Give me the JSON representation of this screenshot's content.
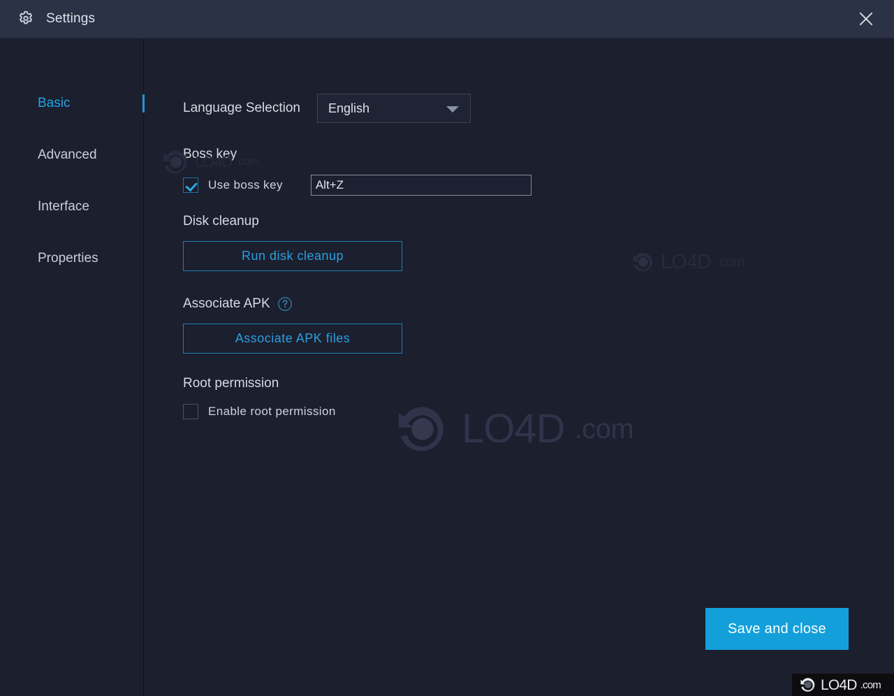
{
  "window": {
    "title": "Settings",
    "gear_icon": "gear-icon",
    "close_icon": "close-icon"
  },
  "sidebar": {
    "items": [
      {
        "label": "Basic",
        "active": true
      },
      {
        "label": "Advanced",
        "active": false
      },
      {
        "label": "Interface",
        "active": false
      },
      {
        "label": "Properties",
        "active": false
      }
    ]
  },
  "main": {
    "language": {
      "label": "Language Selection",
      "value": "English",
      "dropdown_icon": "chevron-down-icon"
    },
    "boss_key": {
      "title": "Boss key",
      "checkbox_label": "Use boss key",
      "checked": true,
      "shortcut_value": "Alt+Z",
      "shortcut_placeholder": "Alt+Z"
    },
    "disk_cleanup": {
      "title": "Disk cleanup",
      "button_label": "Run disk cleanup"
    },
    "associate_apk": {
      "title": "Associate APK",
      "help_icon": "help-icon",
      "button_label": "Associate APK files"
    },
    "root_permission": {
      "title": "Root permission",
      "checkbox_label": "Enable root permission",
      "checked": false
    },
    "save_button_label": "Save and close"
  },
  "watermark": {
    "name": "LO4D",
    "suffix": ".com"
  },
  "colors": {
    "accent": "#13a0da",
    "accent_link": "#2b9fe0",
    "titlebar_bg": "#2b3245",
    "body_bg": "#1b1f2e",
    "nav_active": "#1ea7e8"
  }
}
